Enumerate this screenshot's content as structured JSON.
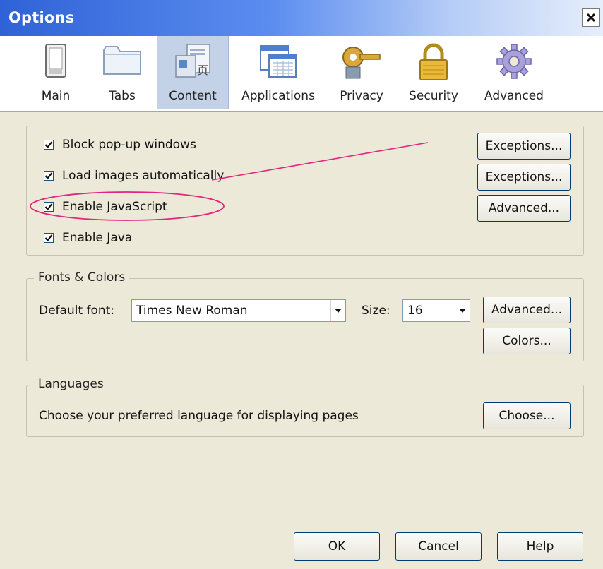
{
  "window": {
    "title": "Options"
  },
  "tabs": [
    {
      "label": "Main",
      "icon": "switch-icon"
    },
    {
      "label": "Tabs",
      "icon": "folder-icon"
    },
    {
      "label": "Content",
      "icon": "content-page-icon",
      "selected": true
    },
    {
      "label": "Applications",
      "icon": "applications-icon"
    },
    {
      "label": "Privacy",
      "icon": "key-icon"
    },
    {
      "label": "Security",
      "icon": "padlock-icon"
    },
    {
      "label": "Advanced",
      "icon": "gear-icon"
    }
  ],
  "content": {
    "checkboxes": [
      {
        "label": "Block pop-up windows",
        "checked": true
      },
      {
        "label": "Load images automatically",
        "checked": true
      },
      {
        "label": "Enable JavaScript",
        "checked": true
      },
      {
        "label": "Enable Java",
        "checked": true
      }
    ],
    "buttons": [
      "Exceptions...",
      "Exceptions...",
      "Advanced..."
    ]
  },
  "fonts": {
    "title": "Fonts & Colors",
    "default_font_label": "Default font:",
    "default_font_value": "Times New Roman",
    "size_label": "Size:",
    "size_value": "16",
    "advanced_button": "Advanced...",
    "colors_button": "Colors..."
  },
  "languages": {
    "title": "Languages",
    "description": "Choose your preferred language for displaying pages",
    "choose_button": "Choose..."
  },
  "footer": {
    "ok": "OK",
    "cancel": "Cancel",
    "help": "Help"
  },
  "colors": {
    "titlebar": "#2f62d6",
    "dialog_bg": "#ece9d8",
    "selected_tab": "#c4d2e8",
    "annotation": "#e0267f"
  }
}
